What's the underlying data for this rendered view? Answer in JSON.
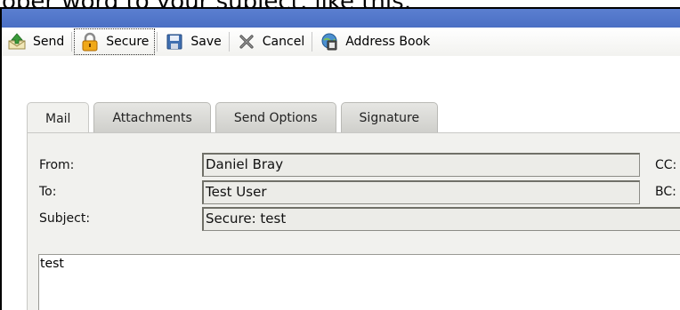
{
  "heading_fragment": "oper word to your subject, like this:",
  "toolbar": {
    "buttons": [
      {
        "label": "Send",
        "icon": "send-icon"
      },
      {
        "label": "Secure",
        "icon": "padlock-icon"
      },
      {
        "label": "Save",
        "icon": "floppy-disk-icon"
      },
      {
        "label": "Cancel",
        "icon": "cancel-x-icon"
      },
      {
        "label": "Address Book",
        "icon": "address-book-icon"
      }
    ]
  },
  "tabs": [
    "Mail",
    "Attachments",
    "Send Options",
    "Signature"
  ],
  "active_tab": "Mail",
  "form": {
    "from_label": "From:",
    "from_value": "Daniel Bray",
    "to_label": "To:",
    "to_value": "Test User",
    "subject_label": "Subject:",
    "subject_value": "Secure: test",
    "cc_label": "CC:",
    "bc_label": "BC:",
    "body": "test"
  },
  "colors": {
    "titlebar": "#4a6fc4",
    "panel": "#f1f1ee",
    "field": "#ecece8"
  }
}
